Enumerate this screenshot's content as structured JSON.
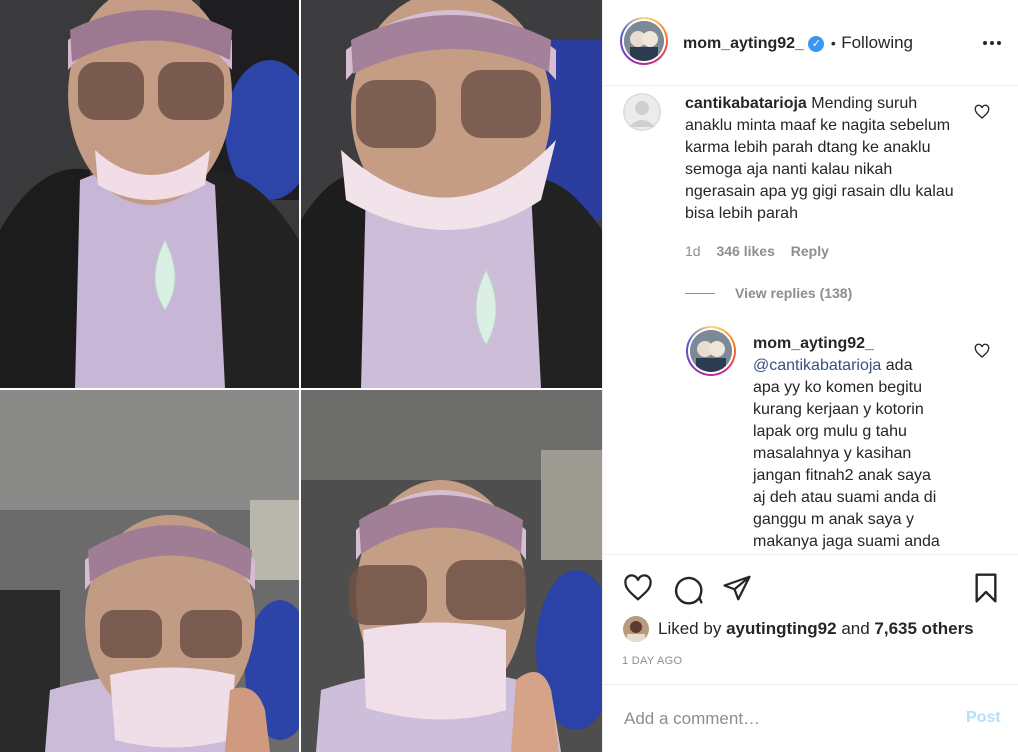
{
  "header": {
    "username": "mom_ayting92_",
    "verified_icon": "verified-badge-icon",
    "separator": "•",
    "follow_status": "Following",
    "more_icon": "more-options-icon"
  },
  "comment": {
    "username": "cantikabatarioja",
    "text": "Mending suruh anaklu minta maaf ke nagita sebelum karma lebih parah dtang ke anaklu semoga aja nanti kalau nikah ngerasain apa yg gigi rasain dlu kalau bisa lebih parah",
    "age": "1d",
    "likes": "346 likes",
    "reply_label": "Reply",
    "view_replies": "View replies (138)"
  },
  "reply": {
    "username": "mom_ayting92_",
    "mention": "@cantikabatarioja",
    "lines": [
      "ada",
      "apa yy ko komen begitu",
      "kurang kerjaan y kotorin",
      "lapak org mulu g tahu",
      "masalahnya y kasihan",
      "jangan fitnah2 anak saya",
      "aj deh atau suami anda di",
      "ganggu m anak saya y",
      "makanya jaga suami anda"
    ]
  },
  "actions": {
    "like_icon": "heart-icon",
    "comment_icon": "comment-icon",
    "share_icon": "share-icon",
    "save_icon": "bookmark-icon",
    "liked_by_prefix": "Liked by",
    "liked_by_user": "ayutingting92",
    "liked_by_and": "and",
    "liked_by_others": "7,635 others",
    "timestamp": "1 DAY AGO"
  },
  "add_comment": {
    "placeholder": "Add a comment…",
    "post_label": "Post"
  },
  "colors": {
    "link": "#385185",
    "verified": "#3897f0",
    "post_disabled": "#b2dffc",
    "muted": "#8e8e8e"
  }
}
